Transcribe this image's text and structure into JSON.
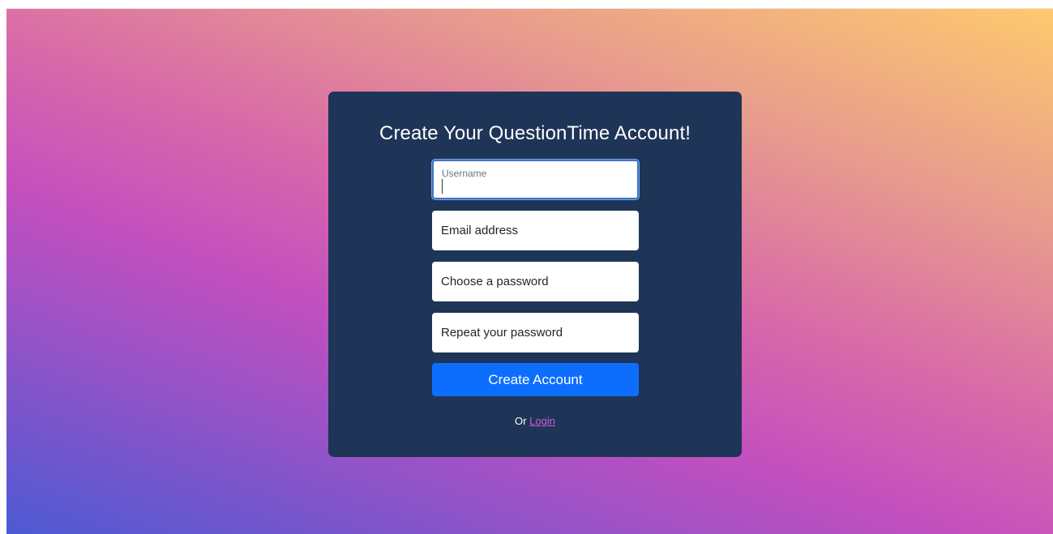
{
  "form": {
    "title": "Create Your QuestionTime Account!",
    "username_label": "Username",
    "username_value": "",
    "email_placeholder": "Email address",
    "password_placeholder": "Choose a password",
    "repeat_password_placeholder": "Repeat your password",
    "submit_label": "Create Account",
    "alt_prefix": "Or",
    "login_link": "Login"
  },
  "colors": {
    "card_bg": "#1e3557",
    "button": "#0d6efd",
    "link": "#d05bd9"
  }
}
